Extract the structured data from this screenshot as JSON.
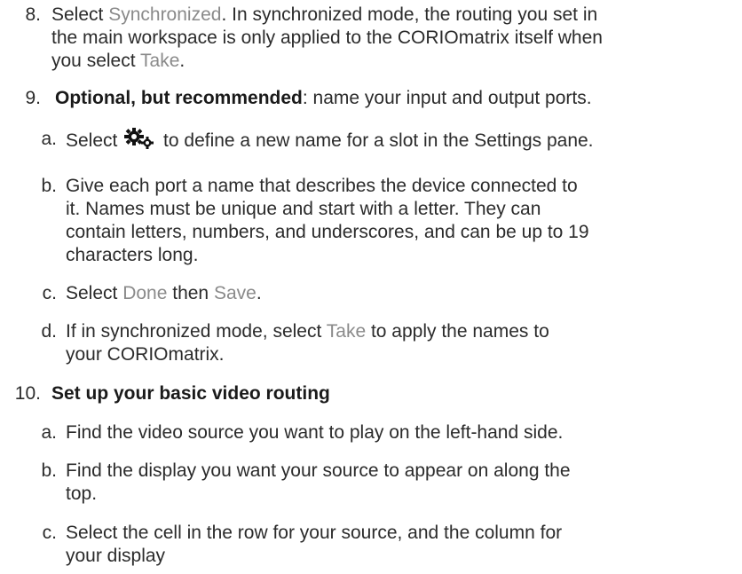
{
  "steps": [
    {
      "number": "8.",
      "line1_pre": "Select ",
      "line1_ui": "Synchronized",
      "line1_post": ". In synchronized mode, the routing you set in",
      "line2": "the main workspace is only applied to the CORIOmatrix itself when",
      "line3_pre": "you select ",
      "line3_ui": "Take",
      "line3_post": "."
    },
    {
      "number": "9.",
      "bold": "Optional, but recommended",
      "rest": ": name your input and output ports.",
      "substeps": [
        {
          "letter": "a.",
          "pre": "Select ",
          "icon": "gears-icon",
          "post": " to define a new name for a slot in the Settings pane."
        },
        {
          "letter": "b.",
          "lines": [
            "Give each port a name that describes the device connected to",
            "it. Names must be unique and start with a letter. They can",
            "contain letters, numbers, and underscores, and can be up to 19",
            "characters long."
          ]
        },
        {
          "letter": "c.",
          "pre": "Select ",
          "ui1": "Done",
          "mid": " then ",
          "ui2": "Save",
          "post": "."
        },
        {
          "letter": "d.",
          "line1_pre": "If in synchronized mode, select ",
          "line1_ui": "Take",
          "line1_post": " to apply the names to",
          "line2": "your CORIOmatrix."
        }
      ]
    },
    {
      "number": "10.",
      "bold": "Set up your basic video routing",
      "substeps": [
        {
          "letter": "a.",
          "lines": [
            "Find the video source you want to play on the left-hand side."
          ]
        },
        {
          "letter": "b.",
          "lines": [
            "Find the display you want your source to appear on along the",
            "top."
          ]
        },
        {
          "letter": "c.",
          "lines": [
            "Select the cell in the row for your source, and the column for",
            "your display"
          ]
        }
      ]
    }
  ]
}
